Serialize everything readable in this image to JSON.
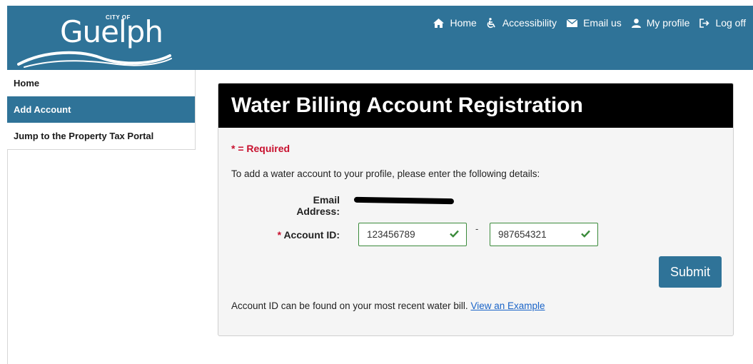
{
  "header": {
    "logo_small": "CITY OF",
    "logo_name": "Guelph",
    "nav": [
      {
        "label": "Home",
        "icon": "home-icon"
      },
      {
        "label": "Accessibility",
        "icon": "wheelchair-icon"
      },
      {
        "label": "Email us",
        "icon": "envelope-icon"
      },
      {
        "label": "My profile",
        "icon": "user-icon"
      },
      {
        "label": "Log off",
        "icon": "logout-icon"
      }
    ]
  },
  "sidebar": {
    "items": [
      {
        "label": "Home",
        "active": false
      },
      {
        "label": "Add Account",
        "active": true
      },
      {
        "label": "Jump to the Property Tax Portal",
        "active": false
      }
    ]
  },
  "form": {
    "title": "Water Billing Account Registration",
    "required_note": "* = Required",
    "instruction": "To add a water account to your profile, please enter the following details:",
    "email_label": "Email Address:",
    "account_label_star": "*",
    "account_label": "Account ID:",
    "account_id_part1": "123456789",
    "account_separator": "-",
    "account_id_part2": "987654321",
    "submit_label": "Submit",
    "footer_text": "Account ID can be found on your most recent water bill.",
    "footer_link": "View an Example"
  },
  "colors": {
    "brand_blue": "#2f7398",
    "required_red": "#c8102e",
    "valid_green": "#3a8a3a",
    "link_blue": "#1a64c8"
  }
}
